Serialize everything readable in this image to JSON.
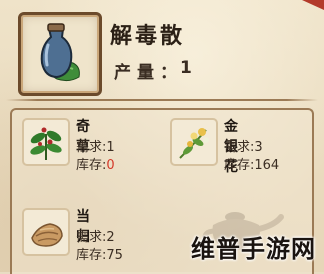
{
  "item": {
    "name": "解毒散",
    "yield_label": "产量：",
    "yield_value": "1",
    "icon": "potion-bottle-icon"
  },
  "ingredients": [
    {
      "name": "奇草",
      "icon": "herb-icon",
      "need_label": "需求:",
      "need": "1",
      "stock_label": "库存:",
      "stock": "0",
      "stock_color": "#d43a2a"
    },
    {
      "name": "金银花",
      "icon": "honeysuckle-icon",
      "need_label": "需求:",
      "need": "3",
      "stock_label": "库存:",
      "stock": "164",
      "stock_color": "#3b2e23"
    },
    {
      "name": "当归",
      "icon": "angelica-root-icon",
      "need_label": "需求:",
      "need": "2",
      "stock_label": "库存:",
      "stock": "75",
      "stock_color": "#3b2e23"
    }
  ],
  "watermark": "维普手游网"
}
